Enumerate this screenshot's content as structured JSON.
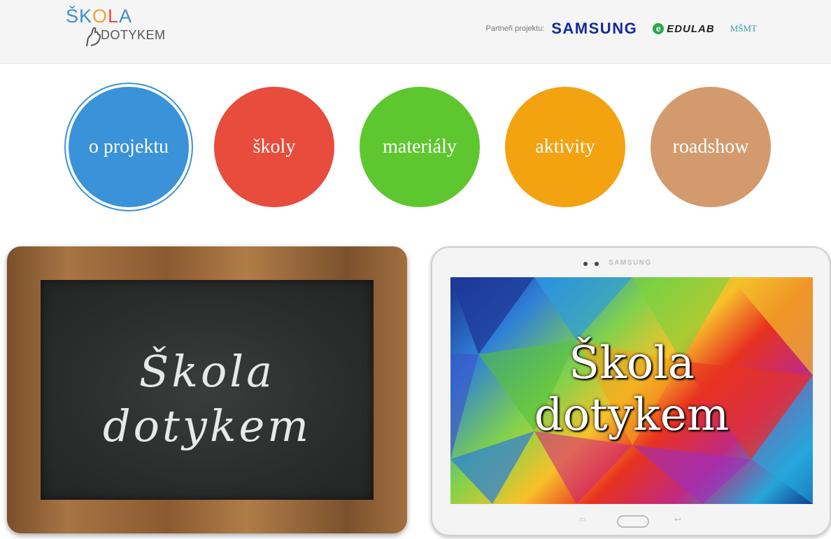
{
  "header": {
    "logo": {
      "top_text": "ŠKOLA",
      "top_letters": [
        {
          "char": "Š",
          "color": "#3a8fd1"
        },
        {
          "char": "K",
          "color": "#3a8fd1"
        },
        {
          "char": "O",
          "color": "#f0a12a"
        },
        {
          "char": "L",
          "color": "#e74c3c"
        },
        {
          "char": "A",
          "color": "#3a8fd1"
        }
      ],
      "bottom_text": "DOTYKEM"
    },
    "partners_label": "Partneři projektu:",
    "partner_samsung": "SAMSUNG",
    "partner_edulab_mark": "e",
    "partner_edulab": "EDULAB",
    "partner_msmt": "MŠMT"
  },
  "nav": {
    "items": [
      {
        "label": "o projektu",
        "color": "#3a92d8",
        "active": true
      },
      {
        "label": "školy",
        "color": "#e74c3c",
        "active": false
      },
      {
        "label": "materiály",
        "color": "#5ec72f",
        "active": false
      },
      {
        "label": "aktivity",
        "color": "#f3a210",
        "active": false
      },
      {
        "label": "roadshow",
        "color": "#d39a6e",
        "active": false
      }
    ]
  },
  "board": {
    "line1": "Škola",
    "line2": "dotykem"
  },
  "tablet": {
    "brand": "SAMSUNG",
    "line1": "Škola",
    "line2": "dotykem"
  }
}
